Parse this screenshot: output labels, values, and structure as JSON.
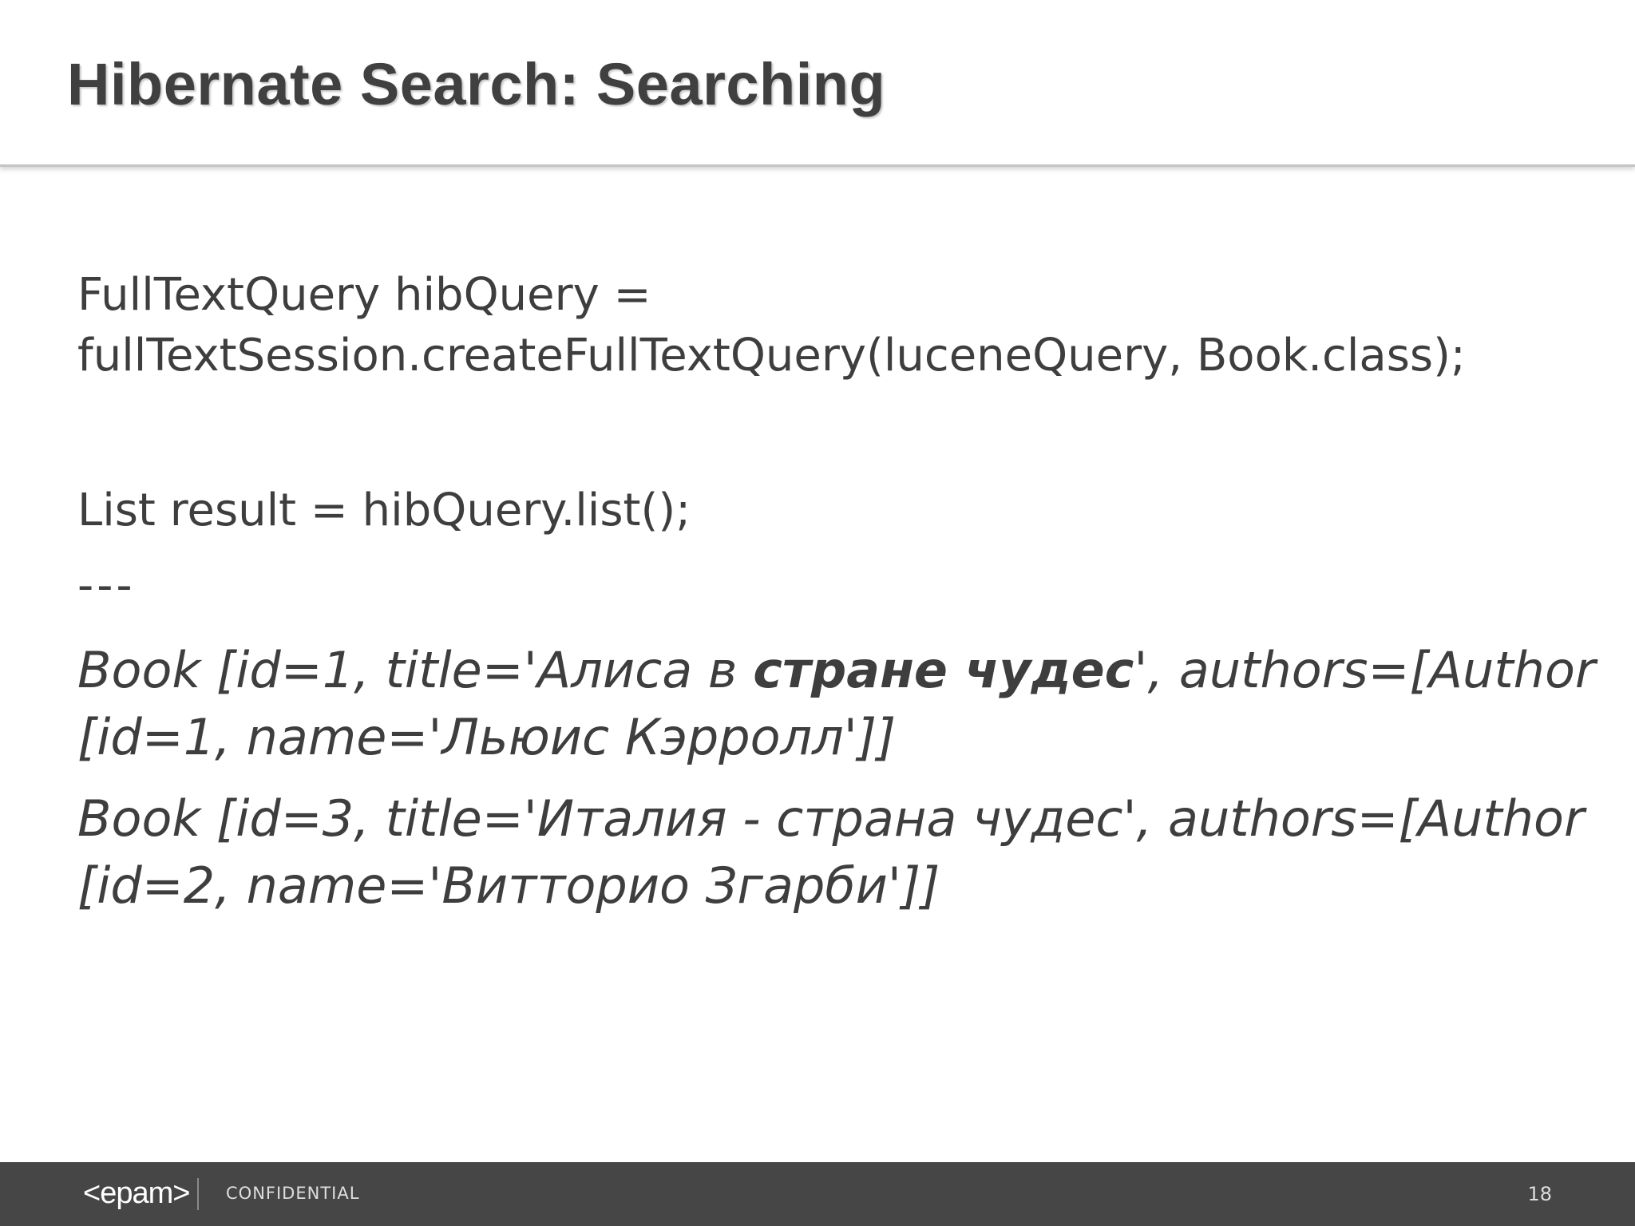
{
  "slide": {
    "title": "Hibernate Search: Searching",
    "code": {
      "line1": "FullTextQuery hibQuery =",
      "line2": "fullTextSession.createFullTextQuery(luceneQuery, Book.class);",
      "line3": "List result = hibQuery.list();",
      "separator": "---"
    },
    "results": [
      {
        "part_a": "Book [id=1, title='Алиса в ",
        "part_bold": "стране чудес",
        "part_c": "', authors=[Author",
        "line2": "[id=1, name='Льюис Кэрролл']]"
      },
      {
        "line1": "Book [id=3, title='Италия - страна чудес', authors=[Author",
        "line2": "[id=2, name='Витторио Згарби']]"
      }
    ]
  },
  "footer": {
    "logo": "<epam>",
    "confidential": "CONFIDENTIAL",
    "page_number": "18"
  }
}
